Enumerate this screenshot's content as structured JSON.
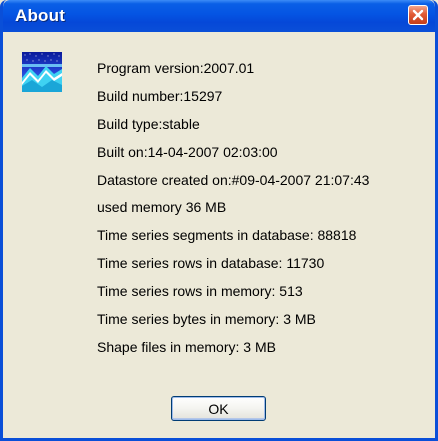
{
  "window": {
    "title": "About",
    "close_icon": "close-icon"
  },
  "app_icon": "app-logo-icon",
  "info_lines": [
    "Program version:2007.01",
    "Build number:15297",
    "Build type:stable",
    "Built on:14-04-2007 02:03:00",
    "Datastore created on:#09-04-2007 21:07:43",
    "used memory 36 MB",
    "Time series segments in database: 88818",
    "Time series rows in database: 11730",
    "Time series rows in memory: 513",
    "Time series bytes in memory: 3 MB",
    "Shape files in memory: 3 MB"
  ],
  "buttons": {
    "ok_label": "OK"
  },
  "colors": {
    "titlebar": "#0a5fe6",
    "close_button": "#e25b36",
    "window_background": "#ece9d8"
  }
}
